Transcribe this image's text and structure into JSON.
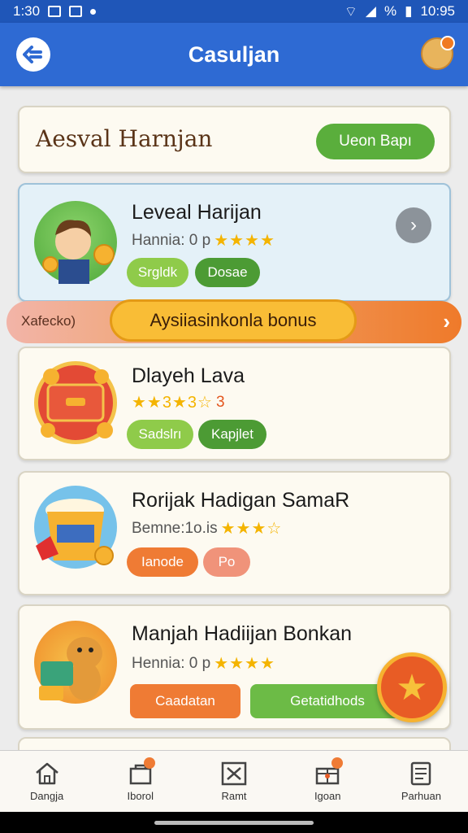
{
  "status": {
    "time_left": "1:30",
    "battery": "%",
    "time_right": "10:95"
  },
  "appbar": {
    "title": "Casuljan"
  },
  "header": {
    "title": "Aesval Harnjan",
    "button": "Ueon Bapı"
  },
  "offers": [
    {
      "name": "Leveal Harijan",
      "sub": "Hannia: 0 p",
      "stars": "★★★★",
      "pills": [
        "Srgldk",
        "Dosae"
      ]
    },
    {
      "name": "Dlayeh Lava",
      "sub": "",
      "stars": "★★3★3☆",
      "extra": "3",
      "pills": [
        "Sadslrı",
        "Kapjlet"
      ]
    },
    {
      "name": "Rorijak Hadigan SamaR",
      "sub": "Bemne:1o.is",
      "stars": "★★★☆",
      "pills": [
        "Ianode",
        "Po"
      ]
    },
    {
      "name": "Manjah Hadiijan Bonkan",
      "sub": "Hennia: 0 p",
      "stars": "★★★★",
      "pills": [
        "Caadatan",
        "Getatidhods"
      ]
    }
  ],
  "banner": {
    "left": "Xafecko)",
    "center": "Aysiiasinkonla bonus"
  },
  "nav": [
    {
      "label": "Dangja",
      "icon": "home-icon"
    },
    {
      "label": "Iborol",
      "icon": "bag-icon",
      "badge": true
    },
    {
      "label": "Ramt",
      "icon": "close-box-icon"
    },
    {
      "label": "Igoan",
      "icon": "gift-icon",
      "badge": true
    },
    {
      "label": "Parhuan",
      "icon": "document-icon"
    }
  ],
  "colors": {
    "appbar": "#2e6ad3",
    "accent_green": "#5aae3c",
    "accent_orange": "#ef7b34",
    "banner_yellow": "#f9bd36"
  }
}
